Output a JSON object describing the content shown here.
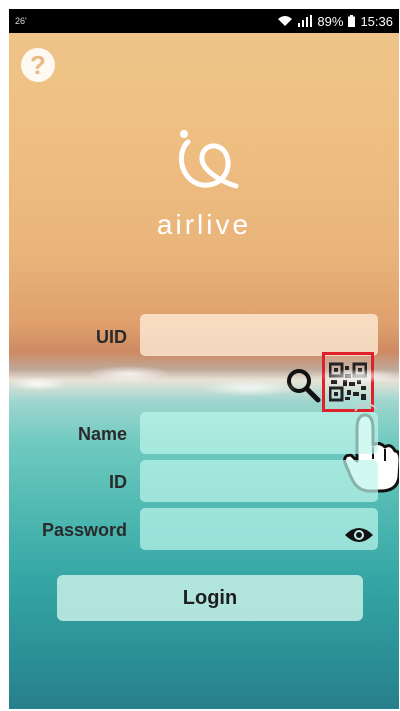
{
  "status_bar": {
    "left_text": "26'",
    "battery": "89%",
    "time": "15:36"
  },
  "icons": {
    "help": "question-mark-icon",
    "search": "magnifier-icon",
    "qr": "qr-code-icon",
    "password_toggle": "eye-icon"
  },
  "help_glyph": "?",
  "logo": {
    "text": "airlive"
  },
  "form": {
    "uid_label": "UID",
    "uid_value": "",
    "name_label": "Name",
    "name_value": "",
    "id_label": "ID",
    "id_value": "",
    "password_label": "Password",
    "password_value": ""
  },
  "login_button": {
    "label": "Login"
  },
  "colors": {
    "highlight_border": "#e0202a",
    "sand": "#efc58a",
    "sea": "#34a5a4"
  }
}
